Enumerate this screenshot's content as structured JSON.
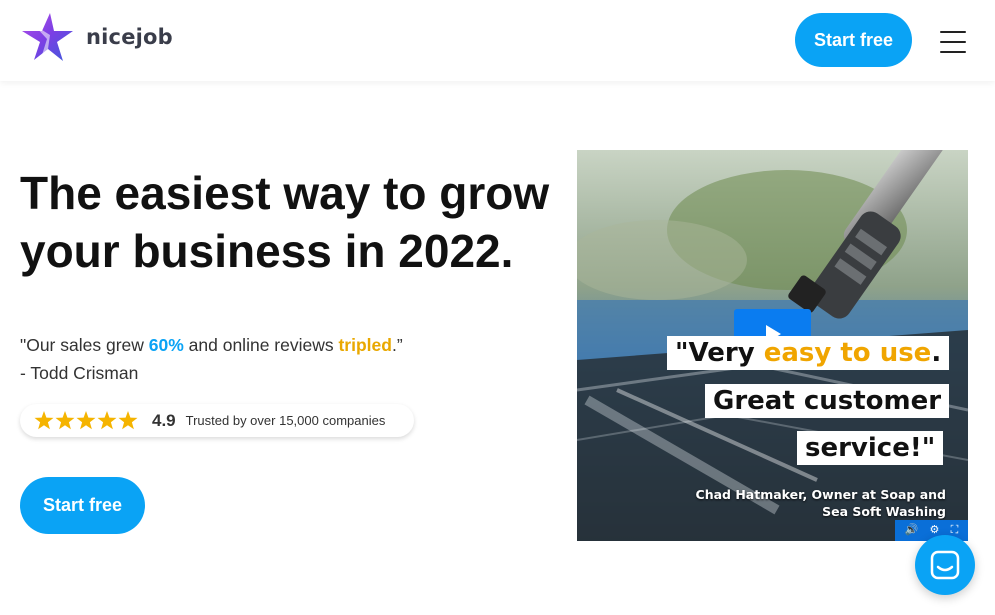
{
  "header": {
    "logo_text": "nicejob",
    "start_free_label": "Start free",
    "menu_icon": "hamburger-menu-icon"
  },
  "hero": {
    "headline_line1": "The easiest way to grow",
    "headline_line2": "your business in 2022.",
    "quote": {
      "open": "\"Our sales grew ",
      "stat1": "60%",
      "middle": " and online reviews ",
      "stat2": "tripled",
      "close": ".”",
      "author": "- Todd Crisman"
    },
    "rating": {
      "stars": 5,
      "score": "4.9",
      "trusted_text": "Trusted by over 15,000 companies"
    },
    "cta_label": "Start free"
  },
  "video": {
    "caption_line1_a": "\"Very ",
    "caption_line1_b": "easy to use",
    "caption_line1_c": ".",
    "caption_line2": "Great customer",
    "caption_line3": "service!\"",
    "attribution_line1": "Chad Hatmaker, Owner at Soap and",
    "attribution_line2": "Sea Soft Washing"
  },
  "colors": {
    "accent": "#0aa3f5",
    "highlight": "#e9a800",
    "star": "#f5b400",
    "logo_purple": "#7b3fe4"
  }
}
